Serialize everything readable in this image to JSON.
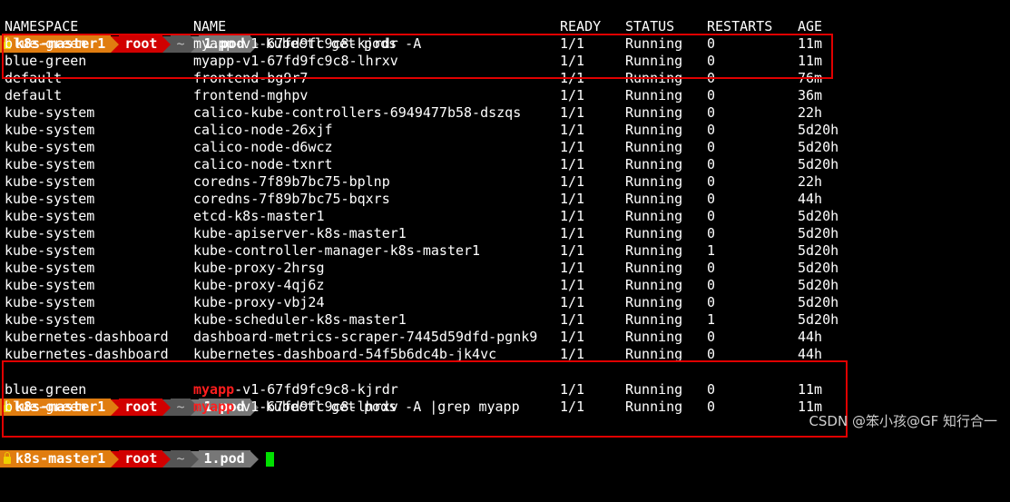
{
  "prompt": {
    "user_host": "k8s-master1",
    "user": "root",
    "home": "~",
    "dir": "1.pod"
  },
  "command1": "kubectl get pods -A",
  "command2": "kubectl get pods -A |grep myapp",
  "headers": {
    "namespace": "NAMESPACE",
    "name": "NAME",
    "ready": "READY",
    "status": "STATUS",
    "restarts": "RESTARTS",
    "age": "AGE"
  },
  "pods": [
    {
      "ns": "blue-green",
      "name": "myapp-v1-67fd9fc9c8-kjrdr",
      "ready": "1/1",
      "status": "Running",
      "restarts": "0",
      "age": "11m"
    },
    {
      "ns": "blue-green",
      "name": "myapp-v1-67fd9fc9c8-lhrxv",
      "ready": "1/1",
      "status": "Running",
      "restarts": "0",
      "age": "11m"
    },
    {
      "ns": "default",
      "name": "frontend-bg9r7",
      "ready": "1/1",
      "status": "Running",
      "restarts": "0",
      "age": "76m"
    },
    {
      "ns": "default",
      "name": "frontend-mghpv",
      "ready": "1/1",
      "status": "Running",
      "restarts": "0",
      "age": "36m"
    },
    {
      "ns": "kube-system",
      "name": "calico-kube-controllers-6949477b58-dszqs",
      "ready": "1/1",
      "status": "Running",
      "restarts": "0",
      "age": "22h"
    },
    {
      "ns": "kube-system",
      "name": "calico-node-26xjf",
      "ready": "1/1",
      "status": "Running",
      "restarts": "0",
      "age": "5d20h"
    },
    {
      "ns": "kube-system",
      "name": "calico-node-d6wcz",
      "ready": "1/1",
      "status": "Running",
      "restarts": "0",
      "age": "5d20h"
    },
    {
      "ns": "kube-system",
      "name": "calico-node-txnrt",
      "ready": "1/1",
      "status": "Running",
      "restarts": "0",
      "age": "5d20h"
    },
    {
      "ns": "kube-system",
      "name": "coredns-7f89b7bc75-bplnp",
      "ready": "1/1",
      "status": "Running",
      "restarts": "0",
      "age": "22h"
    },
    {
      "ns": "kube-system",
      "name": "coredns-7f89b7bc75-bqxrs",
      "ready": "1/1",
      "status": "Running",
      "restarts": "0",
      "age": "44h"
    },
    {
      "ns": "kube-system",
      "name": "etcd-k8s-master1",
      "ready": "1/1",
      "status": "Running",
      "restarts": "0",
      "age": "5d20h"
    },
    {
      "ns": "kube-system",
      "name": "kube-apiserver-k8s-master1",
      "ready": "1/1",
      "status": "Running",
      "restarts": "0",
      "age": "5d20h"
    },
    {
      "ns": "kube-system",
      "name": "kube-controller-manager-k8s-master1",
      "ready": "1/1",
      "status": "Running",
      "restarts": "1",
      "age": "5d20h"
    },
    {
      "ns": "kube-system",
      "name": "kube-proxy-2hrsg",
      "ready": "1/1",
      "status": "Running",
      "restarts": "0",
      "age": "5d20h"
    },
    {
      "ns": "kube-system",
      "name": "kube-proxy-4qj6z",
      "ready": "1/1",
      "status": "Running",
      "restarts": "0",
      "age": "5d20h"
    },
    {
      "ns": "kube-system",
      "name": "kube-proxy-vbj24",
      "ready": "1/1",
      "status": "Running",
      "restarts": "0",
      "age": "5d20h"
    },
    {
      "ns": "kube-system",
      "name": "kube-scheduler-k8s-master1",
      "ready": "1/1",
      "status": "Running",
      "restarts": "1",
      "age": "5d20h"
    },
    {
      "ns": "kubernetes-dashboard",
      "name": "dashboard-metrics-scraper-7445d59dfd-pgnk9",
      "ready": "1/1",
      "status": "Running",
      "restarts": "0",
      "age": "44h"
    },
    {
      "ns": "kubernetes-dashboard",
      "name": "kubernetes-dashboard-54f5b6dc4b-jk4vc",
      "ready": "1/1",
      "status": "Running",
      "restarts": "0",
      "age": "44h"
    }
  ],
  "grep_results": [
    {
      "ns": "blue-green",
      "match": "myapp",
      "rest": "-v1-67fd9fc9c8-kjrdr",
      "ready": "1/1",
      "status": "Running",
      "restarts": "0",
      "age": "11m"
    },
    {
      "ns": "blue-green",
      "match": "myapp",
      "rest": "-v1-67fd9fc9c8-lhrxv",
      "ready": "1/1",
      "status": "Running",
      "restarts": "0",
      "age": "11m"
    }
  ],
  "watermark": "CSDN @笨小孩@GF 知行合一",
  "colors": {
    "background": "#000000",
    "prompt_user": "#e07d10",
    "prompt_root": "#d10000",
    "highlight_box": "#e00000",
    "grep_match": "#ff1e1e",
    "cursor": "#00e000"
  }
}
